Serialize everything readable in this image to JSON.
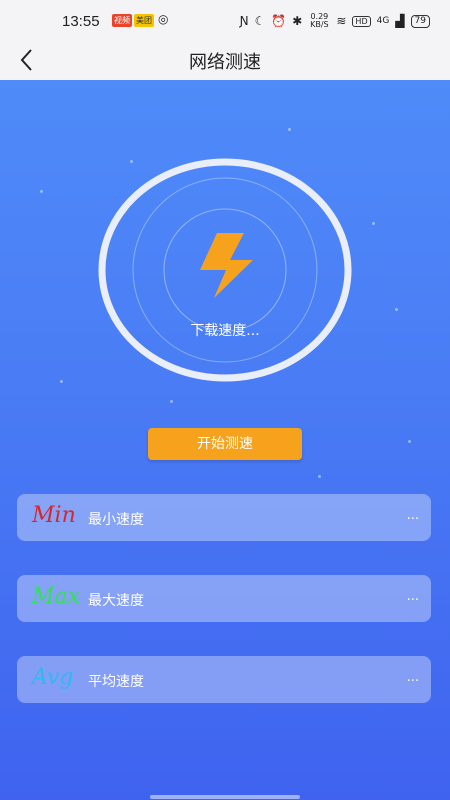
{
  "status_bar": {
    "time": "13:55",
    "badge1": "视频",
    "badge2": "美团",
    "net_speed": "0.29 KB/S",
    "network": "4G",
    "battery": "79"
  },
  "header": {
    "title": "网络测速"
  },
  "gauge": {
    "label": "下载速度...",
    "icon": "lightning-bolt-icon",
    "accent_color": "#f7a21c"
  },
  "start_button": {
    "label": "开始测速"
  },
  "stats": [
    {
      "tag": "Min",
      "tag_color": "#d8262e",
      "label": "最小速度",
      "value": "..."
    },
    {
      "tag": "Max",
      "tag_color": "#33e05a",
      "label": "最大速度",
      "value": "..."
    },
    {
      "tag": "Avg",
      "tag_color": "#2fb8f2",
      "label": "平均速度",
      "value": "..."
    }
  ],
  "colors": {
    "background_top": "#4f8bf9",
    "background_bottom": "#3f63ef",
    "button": "#f7a21c"
  }
}
